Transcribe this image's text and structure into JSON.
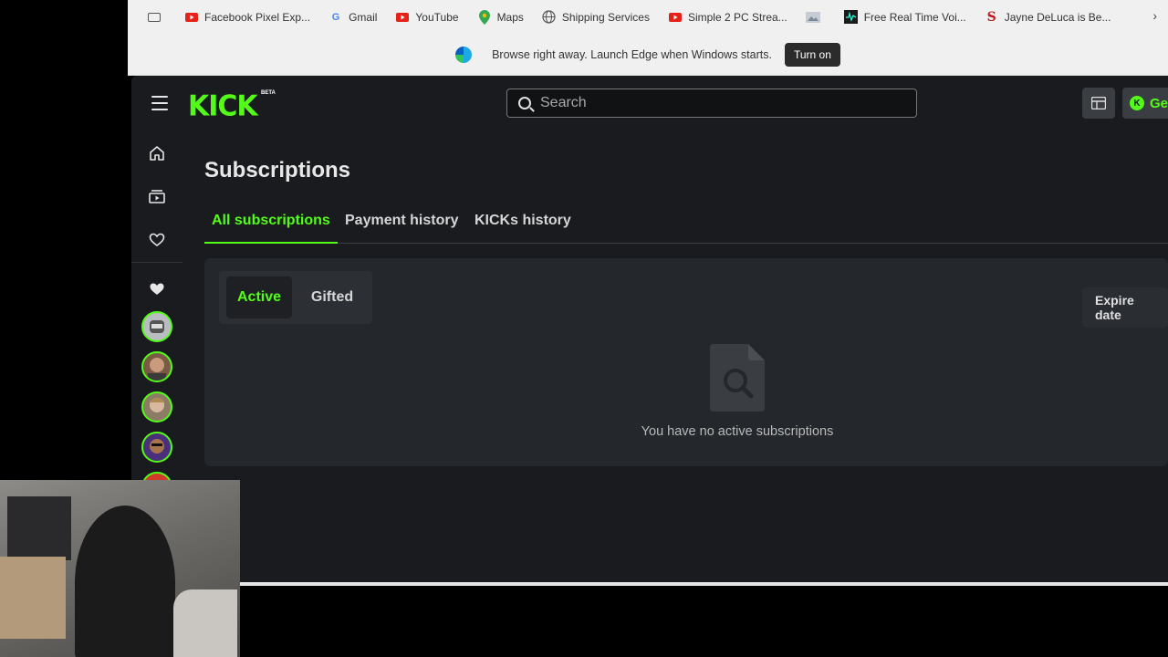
{
  "bookmarks": [
    {
      "label": "Facebook Pixel Exp...",
      "icon": "youtube-icon",
      "color": "#e62117"
    },
    {
      "label": "Gmail",
      "icon": "google-icon",
      "color": "#4285f4"
    },
    {
      "label": "YouTube",
      "icon": "youtube-icon",
      "color": "#e62117"
    },
    {
      "label": "Maps",
      "icon": "maps-pin-icon",
      "color": "#34a853"
    },
    {
      "label": "Shipping Services",
      "icon": "globe-icon",
      "color": "#666666"
    },
    {
      "label": "Simple 2 PC Strea...",
      "icon": "youtube-icon",
      "color": "#e62117"
    },
    {
      "label": "",
      "icon": "image-icon",
      "color": "#7a8a9a"
    },
    {
      "label": "Free Real Time Voi...",
      "icon": "voice-icon",
      "color": "#1a1a1a"
    },
    {
      "label": "Jayne DeLuca is Be...",
      "icon": "s-logo-icon",
      "color": "#c4161c"
    }
  ],
  "infobar": {
    "message": "Browse right away. Launch Edge when Windows starts.",
    "button": "Turn on"
  },
  "header": {
    "logo": "KICK",
    "logo_badge": "BETA",
    "search_placeholder": "Search",
    "get_button": "Get",
    "get_badge": "K"
  },
  "page": {
    "title": "Subscriptions",
    "tabs": [
      "All subscriptions",
      "Payment history",
      "KICKs history"
    ],
    "filters": [
      "Active",
      "Gifted"
    ],
    "sort_label": "Expire date",
    "empty_message": "You have no active subscriptions"
  },
  "colors": {
    "accent": "#53fc18",
    "background": "#191b1f",
    "panel": "#24272c"
  }
}
